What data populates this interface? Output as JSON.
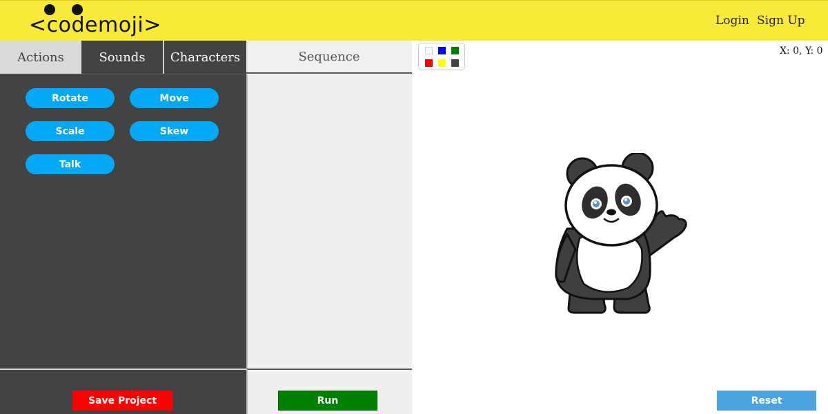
{
  "header": {
    "logo_text": "<codemoji>",
    "nav": {
      "login": "Login",
      "signup": "Sign Up"
    }
  },
  "tabs": {
    "actions": "Actions",
    "sounds": "Sounds",
    "characters": "Characters",
    "sequence": "Sequence"
  },
  "actions": {
    "rotate": "Rotate",
    "move": "Move",
    "scale": "Scale",
    "skew": "Skew",
    "talk": "Talk"
  },
  "footer": {
    "save_label": "Save Project",
    "run_label": "Run",
    "reset_label": "Reset"
  },
  "stage": {
    "coords": "X: 0, Y: 0",
    "character_icon": "panda-icon",
    "palette": [
      "#ffffff",
      "#0000ff",
      "#008000",
      "#ff0000",
      "#ffff00",
      "#444444"
    ]
  },
  "colors": {
    "header": "#f9ea37",
    "panel_dark": "#434343",
    "action_button": "#03a9f4",
    "save": "#ff0000",
    "run": "#008000",
    "reset": "#4aa3df"
  }
}
